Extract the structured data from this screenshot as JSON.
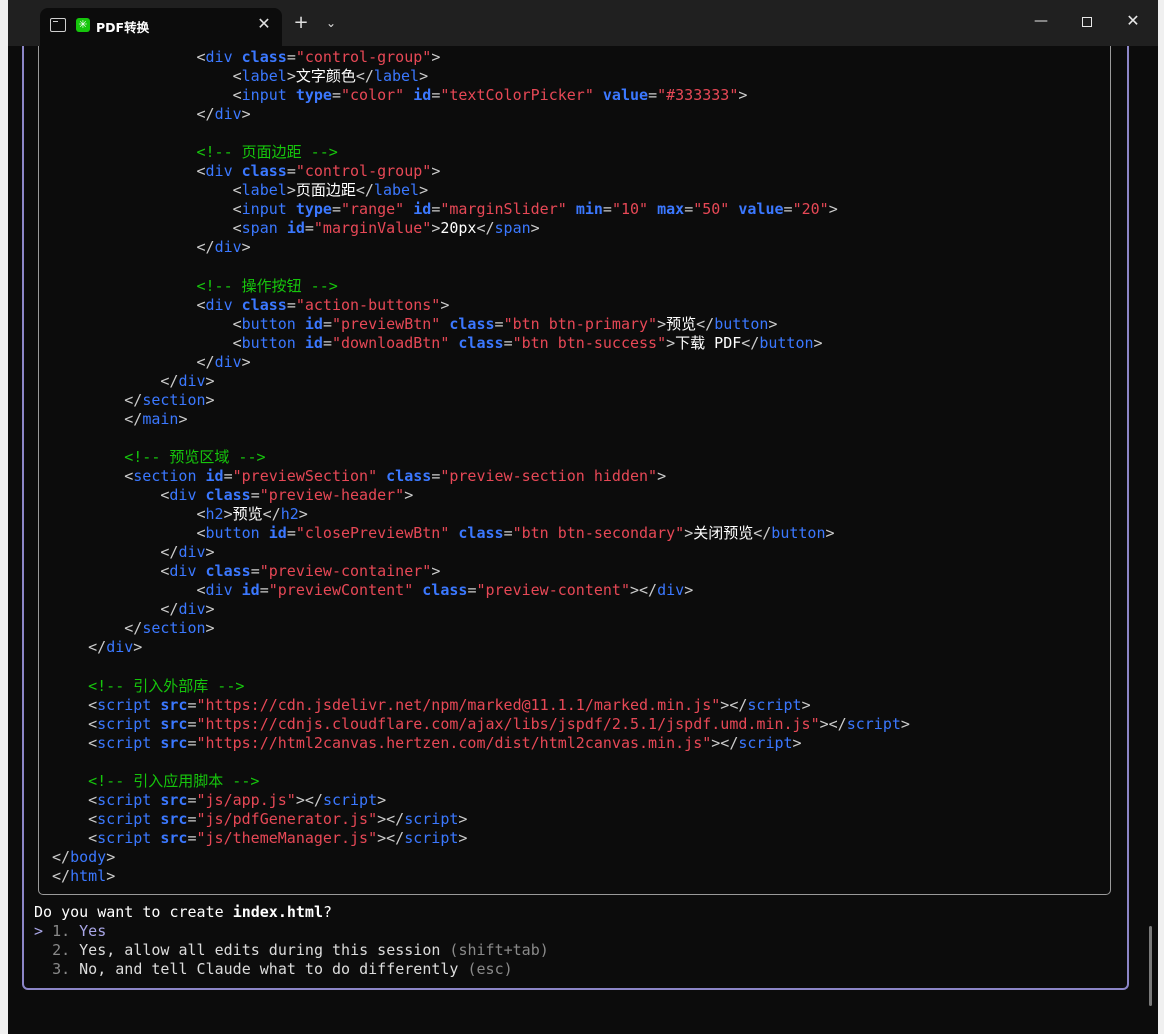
{
  "titlebar": {
    "tab_title": "PDF转换",
    "tab_close": "✕",
    "new_tab": "+",
    "dropdown": "⌄",
    "minimize": "—",
    "close": "✕"
  },
  "code_lines": [
    [
      [
        "sp",
        "            "
      ],
      [
        "p",
        "<"
      ],
      [
        "t",
        "div "
      ],
      [
        "a",
        "class"
      ],
      [
        "p",
        "="
      ],
      [
        "v",
        "\"control-group\""
      ],
      [
        "p",
        ">"
      ]
    ],
    [
      [
        "sp",
        "                "
      ],
      [
        "p",
        "<"
      ],
      [
        "t",
        "label"
      ],
      [
        "p",
        ">"
      ],
      [
        "x",
        "文字颜色"
      ],
      [
        "p",
        "</"
      ],
      [
        "t",
        "label"
      ],
      [
        "p",
        ">"
      ]
    ],
    [
      [
        "sp",
        "                "
      ],
      [
        "p",
        "<"
      ],
      [
        "t",
        "input "
      ],
      [
        "a",
        "type"
      ],
      [
        "p",
        "="
      ],
      [
        "v",
        "\"color\" "
      ],
      [
        "a",
        "id"
      ],
      [
        "p",
        "="
      ],
      [
        "v",
        "\"textColorPicker\" "
      ],
      [
        "a",
        "value"
      ],
      [
        "p",
        "="
      ],
      [
        "v",
        "\"#333333\""
      ],
      [
        "p",
        ">"
      ]
    ],
    [
      [
        "sp",
        "            "
      ],
      [
        "p",
        "</"
      ],
      [
        "t",
        "div"
      ],
      [
        "p",
        ">"
      ]
    ],
    [
      [
        "sp",
        ""
      ]
    ],
    [
      [
        "sp",
        "            "
      ],
      [
        "c",
        "<!-- 页面边距 -->"
      ]
    ],
    [
      [
        "sp",
        "            "
      ],
      [
        "p",
        "<"
      ],
      [
        "t",
        "div "
      ],
      [
        "a",
        "class"
      ],
      [
        "p",
        "="
      ],
      [
        "v",
        "\"control-group\""
      ],
      [
        "p",
        ">"
      ]
    ],
    [
      [
        "sp",
        "                "
      ],
      [
        "p",
        "<"
      ],
      [
        "t",
        "label"
      ],
      [
        "p",
        ">"
      ],
      [
        "x",
        "页面边距"
      ],
      [
        "p",
        "</"
      ],
      [
        "t",
        "label"
      ],
      [
        "p",
        ">"
      ]
    ],
    [
      [
        "sp",
        "                "
      ],
      [
        "p",
        "<"
      ],
      [
        "t",
        "input "
      ],
      [
        "a",
        "type"
      ],
      [
        "p",
        "="
      ],
      [
        "v",
        "\"range\" "
      ],
      [
        "a",
        "id"
      ],
      [
        "p",
        "="
      ],
      [
        "v",
        "\"marginSlider\" "
      ],
      [
        "a",
        "min"
      ],
      [
        "p",
        "="
      ],
      [
        "v",
        "\"10\" "
      ],
      [
        "a",
        "max"
      ],
      [
        "p",
        "="
      ],
      [
        "v",
        "\"50\" "
      ],
      [
        "a",
        "value"
      ],
      [
        "p",
        "="
      ],
      [
        "v",
        "\"20\""
      ],
      [
        "p",
        ">"
      ]
    ],
    [
      [
        "sp",
        "                "
      ],
      [
        "p",
        "<"
      ],
      [
        "t",
        "span "
      ],
      [
        "a",
        "id"
      ],
      [
        "p",
        "="
      ],
      [
        "v",
        "\"marginValue\""
      ],
      [
        "p",
        ">"
      ],
      [
        "x",
        "20px"
      ],
      [
        "p",
        "</"
      ],
      [
        "t",
        "span"
      ],
      [
        "p",
        ">"
      ]
    ],
    [
      [
        "sp",
        "            "
      ],
      [
        "p",
        "</"
      ],
      [
        "t",
        "div"
      ],
      [
        "p",
        ">"
      ]
    ],
    [
      [
        "sp",
        ""
      ]
    ],
    [
      [
        "sp",
        "            "
      ],
      [
        "c",
        "<!-- 操作按钮 -->"
      ]
    ],
    [
      [
        "sp",
        "            "
      ],
      [
        "p",
        "<"
      ],
      [
        "t",
        "div "
      ],
      [
        "a",
        "class"
      ],
      [
        "p",
        "="
      ],
      [
        "v",
        "\"action-buttons\""
      ],
      [
        "p",
        ">"
      ]
    ],
    [
      [
        "sp",
        "                "
      ],
      [
        "p",
        "<"
      ],
      [
        "t",
        "button "
      ],
      [
        "a",
        "id"
      ],
      [
        "p",
        "="
      ],
      [
        "v",
        "\"previewBtn\" "
      ],
      [
        "a",
        "class"
      ],
      [
        "p",
        "="
      ],
      [
        "v",
        "\"btn btn-primary\""
      ],
      [
        "p",
        ">"
      ],
      [
        "x",
        "预览"
      ],
      [
        "p",
        "</"
      ],
      [
        "t",
        "button"
      ],
      [
        "p",
        ">"
      ]
    ],
    [
      [
        "sp",
        "                "
      ],
      [
        "p",
        "<"
      ],
      [
        "t",
        "button "
      ],
      [
        "a",
        "id"
      ],
      [
        "p",
        "="
      ],
      [
        "v",
        "\"downloadBtn\" "
      ],
      [
        "a",
        "class"
      ],
      [
        "p",
        "="
      ],
      [
        "v",
        "\"btn btn-success\""
      ],
      [
        "p",
        ">"
      ],
      [
        "x",
        "下载 PDF"
      ],
      [
        "p",
        "</"
      ],
      [
        "t",
        "button"
      ],
      [
        "p",
        ">"
      ]
    ],
    [
      [
        "sp",
        "            "
      ],
      [
        "p",
        "</"
      ],
      [
        "t",
        "div"
      ],
      [
        "p",
        ">"
      ]
    ],
    [
      [
        "sp",
        "        "
      ],
      [
        "p",
        "</"
      ],
      [
        "t",
        "div"
      ],
      [
        "p",
        ">"
      ]
    ],
    [
      [
        "sp",
        "    "
      ],
      [
        "p",
        "</"
      ],
      [
        "t",
        "section"
      ],
      [
        "p",
        ">"
      ]
    ],
    [
      [
        "sp",
        "    "
      ],
      [
        "p",
        "</"
      ],
      [
        "t",
        "main"
      ],
      [
        "p",
        ">"
      ]
    ],
    [
      [
        "sp",
        ""
      ]
    ],
    [
      [
        "sp",
        "    "
      ],
      [
        "c",
        "<!-- 预览区域 -->"
      ]
    ],
    [
      [
        "sp",
        "    "
      ],
      [
        "p",
        "<"
      ],
      [
        "t",
        "section "
      ],
      [
        "a",
        "id"
      ],
      [
        "p",
        "="
      ],
      [
        "v",
        "\"previewSection\" "
      ],
      [
        "a",
        "class"
      ],
      [
        "p",
        "="
      ],
      [
        "v",
        "\"preview-section hidden\""
      ],
      [
        "p",
        ">"
      ]
    ],
    [
      [
        "sp",
        "        "
      ],
      [
        "p",
        "<"
      ],
      [
        "t",
        "div "
      ],
      [
        "a",
        "class"
      ],
      [
        "p",
        "="
      ],
      [
        "v",
        "\"preview-header\""
      ],
      [
        "p",
        ">"
      ]
    ],
    [
      [
        "sp",
        "            "
      ],
      [
        "p",
        "<"
      ],
      [
        "t",
        "h2"
      ],
      [
        "p",
        ">"
      ],
      [
        "x",
        "预览"
      ],
      [
        "p",
        "</"
      ],
      [
        "t",
        "h2"
      ],
      [
        "p",
        ">"
      ]
    ],
    [
      [
        "sp",
        "            "
      ],
      [
        "p",
        "<"
      ],
      [
        "t",
        "button "
      ],
      [
        "a",
        "id"
      ],
      [
        "p",
        "="
      ],
      [
        "v",
        "\"closePreviewBtn\" "
      ],
      [
        "a",
        "class"
      ],
      [
        "p",
        "="
      ],
      [
        "v",
        "\"btn btn-secondary\""
      ],
      [
        "p",
        ">"
      ],
      [
        "x",
        "关闭预览"
      ],
      [
        "p",
        "</"
      ],
      [
        "t",
        "button"
      ],
      [
        "p",
        ">"
      ]
    ],
    [
      [
        "sp",
        "        "
      ],
      [
        "p",
        "</"
      ],
      [
        "t",
        "div"
      ],
      [
        "p",
        ">"
      ]
    ],
    [
      [
        "sp",
        "        "
      ],
      [
        "p",
        "<"
      ],
      [
        "t",
        "div "
      ],
      [
        "a",
        "class"
      ],
      [
        "p",
        "="
      ],
      [
        "v",
        "\"preview-container\""
      ],
      [
        "p",
        ">"
      ]
    ],
    [
      [
        "sp",
        "            "
      ],
      [
        "p",
        "<"
      ],
      [
        "t",
        "div "
      ],
      [
        "a",
        "id"
      ],
      [
        "p",
        "="
      ],
      [
        "v",
        "\"previewContent\" "
      ],
      [
        "a",
        "class"
      ],
      [
        "p",
        "="
      ],
      [
        "v",
        "\"preview-content\""
      ],
      [
        "p",
        "></"
      ],
      [
        "t",
        "div"
      ],
      [
        "p",
        ">"
      ]
    ],
    [
      [
        "sp",
        "        "
      ],
      [
        "p",
        "</"
      ],
      [
        "t",
        "div"
      ],
      [
        "p",
        ">"
      ]
    ],
    [
      [
        "sp",
        "    "
      ],
      [
        "p",
        "</"
      ],
      [
        "t",
        "section"
      ],
      [
        "p",
        ">"
      ]
    ],
    [
      [
        "sp",
        ""
      ],
      [
        "p",
        "</"
      ],
      [
        "t",
        "div"
      ],
      [
        "p",
        ">"
      ]
    ],
    [
      [
        "sp",
        ""
      ]
    ],
    [
      [
        "sp",
        ""
      ],
      [
        "c",
        "<!-- 引入外部库 -->"
      ]
    ],
    [
      [
        "sp",
        ""
      ],
      [
        "p",
        "<"
      ],
      [
        "t",
        "script "
      ],
      [
        "a",
        "src"
      ],
      [
        "p",
        "="
      ],
      [
        "v",
        "\"https://cdn.jsdelivr.net/npm/marked@11.1.1/marked.min.js\""
      ],
      [
        "p",
        "></"
      ],
      [
        "t",
        "script"
      ],
      [
        "p",
        ">"
      ]
    ],
    [
      [
        "sp",
        ""
      ],
      [
        "p",
        "<"
      ],
      [
        "t",
        "script "
      ],
      [
        "a",
        "src"
      ],
      [
        "p",
        "="
      ],
      [
        "v",
        "\"https://cdnjs.cloudflare.com/ajax/libs/jspdf/2.5.1/jspdf.umd.min.js\""
      ],
      [
        "p",
        "></"
      ],
      [
        "t",
        "script"
      ],
      [
        "p",
        ">"
      ]
    ],
    [
      [
        "sp",
        ""
      ],
      [
        "p",
        "<"
      ],
      [
        "t",
        "script "
      ],
      [
        "a",
        "src"
      ],
      [
        "p",
        "="
      ],
      [
        "v",
        "\"https://html2canvas.hertzen.com/dist/html2canvas.min.js\""
      ],
      [
        "p",
        "></"
      ],
      [
        "t",
        "script"
      ],
      [
        "p",
        ">"
      ]
    ],
    [
      [
        "sp",
        ""
      ]
    ],
    [
      [
        "sp",
        ""
      ],
      [
        "c",
        "<!-- 引入应用脚本 -->"
      ]
    ],
    [
      [
        "sp",
        ""
      ],
      [
        "p",
        "<"
      ],
      [
        "t",
        "script "
      ],
      [
        "a",
        "src"
      ],
      [
        "p",
        "="
      ],
      [
        "v",
        "\"js/app.js\""
      ],
      [
        "p",
        "></"
      ],
      [
        "t",
        "script"
      ],
      [
        "p",
        ">"
      ]
    ],
    [
      [
        "sp",
        ""
      ],
      [
        "p",
        "<"
      ],
      [
        "t",
        "script "
      ],
      [
        "a",
        "src"
      ],
      [
        "p",
        "="
      ],
      [
        "v",
        "\"js/pdfGenerator.js\""
      ],
      [
        "p",
        "></"
      ],
      [
        "t",
        "script"
      ],
      [
        "p",
        ">"
      ]
    ],
    [
      [
        "sp",
        ""
      ],
      [
        "p",
        "<"
      ],
      [
        "t",
        "script "
      ],
      [
        "a",
        "src"
      ],
      [
        "p",
        "="
      ],
      [
        "v",
        "\"js/themeManager.js\""
      ],
      [
        "p",
        "></"
      ],
      [
        "t",
        "script"
      ],
      [
        "p",
        ">"
      ]
    ],
    [
      [
        "p",
        "</"
      ],
      [
        "t",
        "body"
      ],
      [
        "p",
        ">"
      ]
    ],
    [
      [
        "p",
        "</"
      ],
      [
        "t",
        "html"
      ],
      [
        "p",
        ">"
      ]
    ]
  ],
  "prompt": {
    "question_prefix": "Do you want to create ",
    "question_file": "index.html",
    "question_suffix": "?",
    "cursor": "> ",
    "options": [
      {
        "number": "1.",
        "label": "Yes",
        "hint": ""
      },
      {
        "number": "2.",
        "label": "Yes, allow all edits during this session",
        "hint": "(shift+tab)"
      },
      {
        "number": "3.",
        "label": "No, and tell Claude what to do differently",
        "hint": "(esc)"
      }
    ]
  },
  "colors": {
    "tag": "#3b78ff",
    "attr_value": "#e74856",
    "comment": "#16c60c",
    "frame": "#8c86c8",
    "selected_option": "#a9a6e6"
  }
}
